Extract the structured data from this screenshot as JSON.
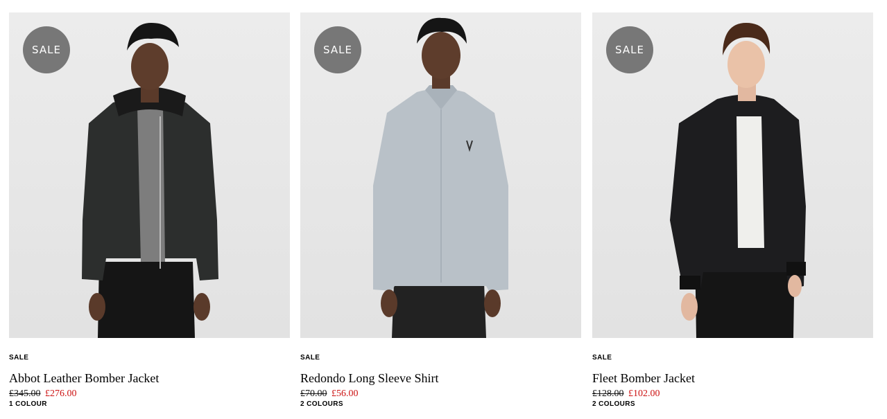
{
  "products": [
    {
      "badge": "SALE",
      "label": "SALE",
      "name": "Abbot Leather Bomber Jacket",
      "price_was": "£345.00",
      "price_now": "£276.00",
      "colours": "1 COLOUR",
      "image": "model-leather-bomber-jacket"
    },
    {
      "badge": "SALE",
      "label": "SALE",
      "name": "Redondo Long Sleeve Shirt",
      "price_was": "£70.00",
      "price_now": "£56.00",
      "colours": "2 COLOURS",
      "image": "model-light-blue-shirt"
    },
    {
      "badge": "SALE",
      "label": "SALE",
      "name": "Fleet Bomber Jacket",
      "price_was": "£128.00",
      "price_now": "£102.00",
      "colours": "2 COLOURS",
      "image": "model-black-bomber-jacket"
    }
  ],
  "colors": {
    "badge_bg": "#777777",
    "sale_price": "#cc1111",
    "image_bg": "#e6e6e6"
  }
}
